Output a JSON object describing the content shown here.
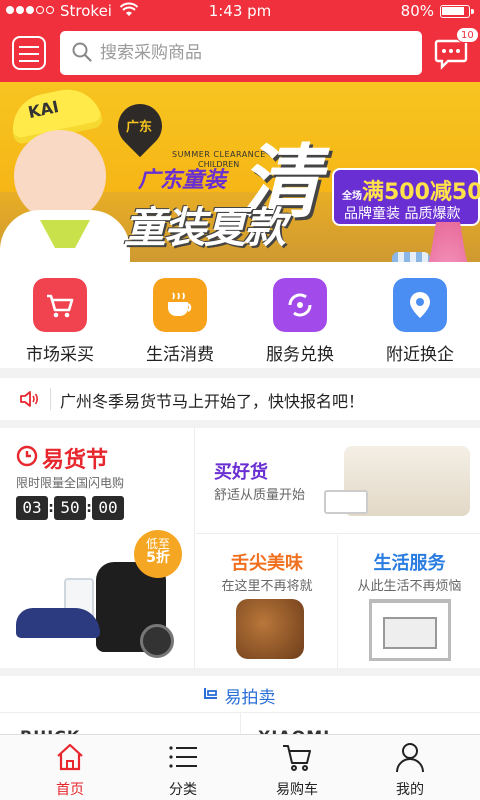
{
  "status_bar": {
    "carrier": "Strokei",
    "time": "1:43 pm",
    "battery": "80%"
  },
  "header": {
    "search_placeholder": "搜索采购商品",
    "message_count": "10"
  },
  "banner": {
    "hat_text": "KAI",
    "location_tag": "广东",
    "summer_text": "SUMMER CLEARANCE",
    "children_text": "CHILDREN",
    "brand_text": "广东童装",
    "main_text": "童装夏款",
    "big_char": "清",
    "promo_prefix": "全场",
    "promo_main": "满500减50",
    "promo_sub": "品牌童装 品质爆款",
    "active_slide": 1,
    "slide_count": 4
  },
  "quick_menu": [
    {
      "label": "市场采买",
      "icon": "cart-icon",
      "color": "#f0434f"
    },
    {
      "label": "生活消费",
      "icon": "cup-icon",
      "color": "#f7a21b"
    },
    {
      "label": "服务兑换",
      "icon": "exchange-icon",
      "color": "#a24bea"
    },
    {
      "label": "附近换企",
      "icon": "location-icon",
      "color": "#4b8ef3"
    }
  ],
  "notice": {
    "text": "广州冬季易货节马上开始了，快快报名吧！"
  },
  "promo_grid": {
    "festival": {
      "title": "易货节",
      "subtitle": "限时限量全国闪电购",
      "countdown": [
        "03",
        "50",
        "00"
      ],
      "discount_top": "低至",
      "discount_value": "5折"
    },
    "good_goods": {
      "title": "买好货",
      "subtitle": "舒适从质量开始"
    },
    "food": {
      "title": "舌尖美味",
      "subtitle": "在这里不再将就"
    },
    "service": {
      "title": "生活服务",
      "subtitle": "从此生活不再烦恼"
    }
  },
  "auction": {
    "label": "易拍卖"
  },
  "brands": [
    "BUICK",
    "XIAOMI"
  ],
  "tabbar": [
    {
      "label": "首页",
      "icon": "home-icon",
      "active": true
    },
    {
      "label": "分类",
      "icon": "list-icon",
      "active": false
    },
    {
      "label": "易购车",
      "icon": "cart-icon",
      "active": false
    },
    {
      "label": "我的",
      "icon": "user-icon",
      "active": false
    }
  ],
  "colors": {
    "brand_red": "#f0303c",
    "festival_red": "#e8262e",
    "purple": "#6a2fd2",
    "orange": "#f07020",
    "blue": "#2a7de0"
  }
}
